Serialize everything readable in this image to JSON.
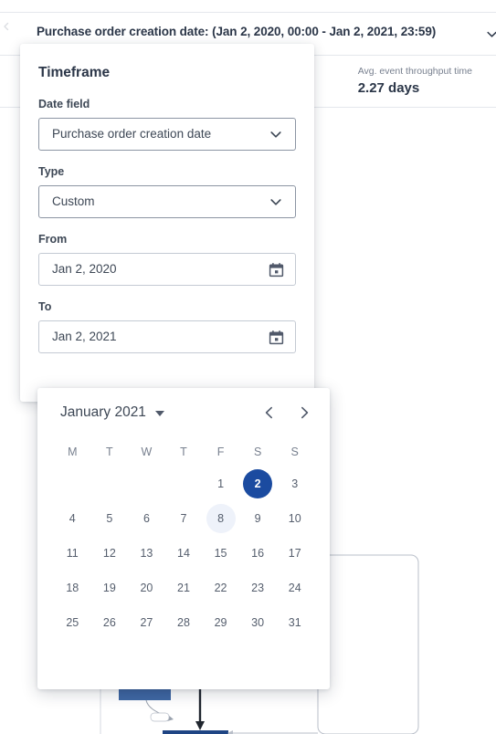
{
  "filter_bar": {
    "label": "Purchase order creation date: (Jan 2, 2020, 00:00 - Jan 2, 2021, 23:59)",
    "chevron_icon": "chevron-down-icon",
    "left_icon": "chevron-left-icon"
  },
  "kpi": {
    "label": "Avg. event throughput time",
    "value": "2.27 days"
  },
  "timeframe_panel": {
    "title": "Timeframe",
    "fields": [
      {
        "label": "Date field",
        "value": "Purchase order creation date",
        "icon": "chevron-down-icon",
        "control": "select"
      },
      {
        "label": "Type",
        "value": "Custom",
        "icon": "chevron-down-icon",
        "control": "select"
      },
      {
        "label": "From",
        "value": "Jan 2, 2020",
        "icon": "calendar-icon",
        "control": "date"
      },
      {
        "label": "To",
        "value": "Jan 2, 2021",
        "icon": "calendar-icon",
        "control": "date"
      }
    ]
  },
  "calendar": {
    "month_label": "January 2021",
    "month_caret_icon": "caret-down-icon",
    "prev_icon": "chevron-left-icon",
    "next_icon": "chevron-right-icon",
    "weekdays": [
      "M",
      "T",
      "W",
      "T",
      "F",
      "S",
      "S"
    ],
    "weeks": [
      [
        "",
        "",
        "",
        "",
        "1",
        "2",
        "3"
      ],
      [
        "4",
        "5",
        "6",
        "7",
        "8",
        "9",
        "10"
      ],
      [
        "11",
        "12",
        "13",
        "14",
        "15",
        "16",
        "17"
      ],
      [
        "18",
        "19",
        "20",
        "21",
        "22",
        "23",
        "24"
      ],
      [
        "25",
        "26",
        "27",
        "28",
        "29",
        "30",
        "31"
      ]
    ],
    "selected_day": "2",
    "hovered_day": "8"
  },
  "colors": {
    "selected_day_bg": "#1b4ba0",
    "hovered_day_bg": "#eef2fa",
    "text_primary": "#2b3648",
    "text_secondary": "#78808f",
    "border": "#e4e7ec",
    "diagram_node": "#2a5699"
  }
}
